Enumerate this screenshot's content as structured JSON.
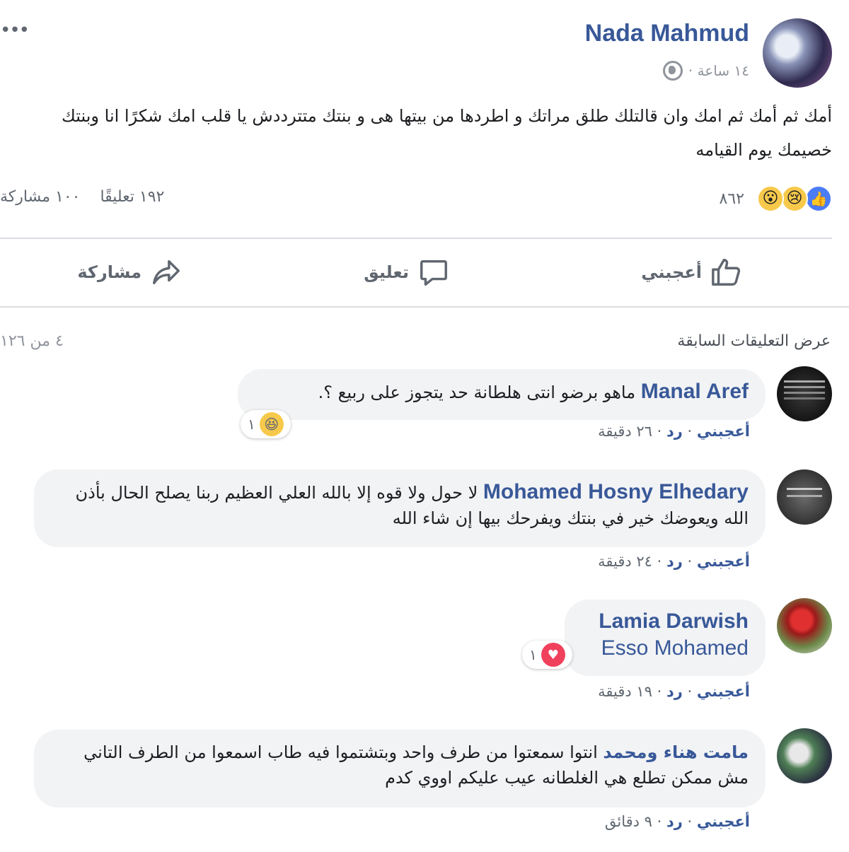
{
  "post": {
    "author": "Nada Mahmud",
    "time": "١٤ ساعة ·",
    "text": "أمك ثم أمك ثم امك وان قالتلك طلق مراتك و اطردها من بيتها هى و بنتك متترددش يا قلب امك شكرًا انا وبنتك خصيمك يوم القيامه",
    "more": "•••"
  },
  "reactions": {
    "count": "٨٦٢",
    "icons": [
      "like-icon",
      "sad-icon",
      "wow-icon"
    ],
    "comments": "١٩٢ تعليقًا",
    "shares": "١٠٠ مشاركة"
  },
  "actions": {
    "like": "أعجبني",
    "comment": "تعليق",
    "share": "مشاركة"
  },
  "comments_section": {
    "view_previous": "عرض التعليقات السابقة",
    "count": "٤ من ١٢٦"
  },
  "comments": [
    {
      "name": "Manal Aref",
      "text": "ماهو برضو انتى هلطانة حد يتجوز على ربيع ؟.",
      "reaction_count": "١",
      "like": "أعجبني",
      "reply": "رد",
      "time": "٢٦ دقيقة"
    },
    {
      "name": "Mohamed Hosny Elhedary",
      "text": "لا حول ولا قوه إلا بالله العلي العظيم ربنا يصلح الحال بأذن الله ويعوضك خير في بنتك ويفرحك بيها إن شاء الله",
      "like": "أعجبني",
      "reply": "رد",
      "time": "٢٤ دقيقة"
    },
    {
      "name": "Lamia Darwish",
      "tag": "Esso Mohamed",
      "reaction_count": "١",
      "like": "أعجبني",
      "reply": "رد",
      "time": "١٩ دقيقة"
    },
    {
      "name": "مامت هناء ومحمد",
      "text": "انتوا سمعتوا من طرف واحد وبتشتموا فيه طاب اسمعوا من الطرف التاني مش ممكن تطلع هي الغلطانه عيب عليكم اووي كدم",
      "like": "أعجبني",
      "reply": "رد",
      "time": "٩ دقائق"
    }
  ],
  "colors": {
    "link": "#385898",
    "meta": "#90949c",
    "bubble": "#f2f3f5",
    "like_blue": "#4a7cf6",
    "love_red": "#f0415c"
  }
}
